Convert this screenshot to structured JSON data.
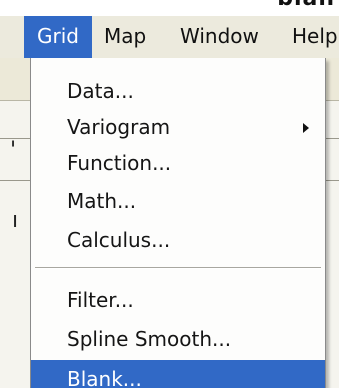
{
  "window_title_partial": "blan",
  "menubar": {
    "items": [
      {
        "label": "Grid"
      },
      {
        "label": "Map"
      },
      {
        "label": "Window"
      },
      {
        "label": "Help"
      }
    ]
  },
  "grid_menu": {
    "items": [
      {
        "label": "Data..."
      },
      {
        "label": "Variogram",
        "submenu_icon": "submenu-arrow-icon"
      },
      {
        "label": "Function..."
      },
      {
        "label": "Math..."
      },
      {
        "label": "Calculus..."
      },
      {
        "label": "Filter..."
      },
      {
        "label": "Spline Smooth..."
      },
      {
        "label": "Blank..."
      }
    ]
  },
  "colors": {
    "highlight": "#3169c6",
    "menubar_bg": "#eceadd",
    "menu_bg": "#fdfdfc"
  }
}
